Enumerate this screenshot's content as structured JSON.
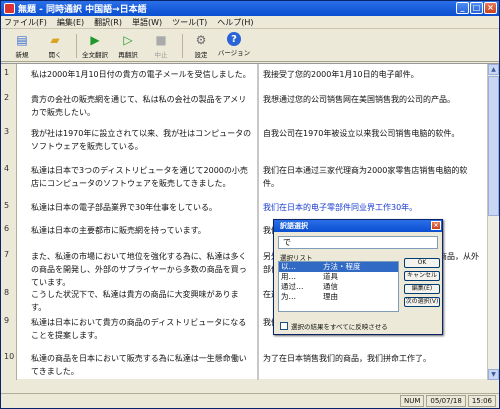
{
  "window": {
    "title": "無題 - 同時通訳 中国語→日本語"
  },
  "menu": [
    "ファイル(F)",
    "編集(E)",
    "翻訳(R)",
    "単語(W)",
    "ツール(T)",
    "ヘルプ(H)"
  ],
  "toolbar": [
    {
      "label": "新規",
      "icon": "new-doc-icon",
      "glyph": "▤"
    },
    {
      "label": "開く",
      "icon": "open-folder-icon",
      "glyph": "📂"
    },
    {
      "label": "全文翻訳",
      "icon": "translate-all-icon",
      "glyph": "▶"
    },
    {
      "label": "再翻訳",
      "icon": "retranslate-icon",
      "glyph": "▶"
    },
    {
      "label": "中止",
      "icon": "stop-icon",
      "glyph": "■",
      "disabled": true
    },
    {
      "label": "設定",
      "icon": "settings-icon",
      "glyph": "⚙"
    },
    {
      "label": "バージョン",
      "icon": "help-version-icon",
      "glyph": "?"
    }
  ],
  "rows": [
    {
      "n": "1",
      "src": "私は2000年1月10日付の貴方の電子メールを受信しました。",
      "dst": "我接受了您的2000年1月10日的电子邮件。"
    },
    {
      "n": "2",
      "src": "貴方の会社の販売網を通じて、私は私の会社の製品をアメリカで販売したい。",
      "dst": "我想通过您的公司销售网在美国销售我的公司的产品。"
    },
    {
      "n": "3",
      "src": "我が社は1970年に設立されて以来、我が社はコンピュータのソフトウェアを販売している。",
      "dst": "自我公司在1970年被设立以来我公司销售电脑的软件。"
    },
    {
      "n": "4",
      "src": "私達は日本で3つのディストリビュータを通じて2000の小売店にコンピュータのソフトウェアを販売してきました。",
      "dst": "我们在日本通过三家代理商为2000家零售店销售电脑的软件。"
    },
    {
      "n": "5",
      "src": "私達は日本の電子部品業界で30年仕事をしている。",
      "dst": "我们在日本的电子零部件同业界工作30年。"
    },
    {
      "n": "6",
      "src": "私達は日本の主要都市に販売網を持っています。",
      "dst": "我们在日本的主要城市有销售网络。"
    },
    {
      "n": "7",
      "src": "また、私達の市場において地位を強化する為に、私達は多くの商品を開発し、外部のサプライヤーから多数の商品を買っています。",
      "dst": "另外，为了在我们的市场强化地位，我们开发很多商品，从外部供应商购买多数商品。"
    },
    {
      "n": "8",
      "src": "こうした状況下で、私達は貴方の商品に大変興味があります。",
      "dst": "在这样的状况下，我们对您的商品非常感兴趣。"
    },
    {
      "n": "9",
      "src": "私達は日本において貴方の商品のディストリビュータになることを提案します。",
      "dst": "我们提议在日本成为您的商品的代理商。"
    },
    {
      "n": "10",
      "src": "私達の商品を日本において販売する為に私達は一生懸命働いてきました。",
      "dst": "为了在日本销售我们的商品，我们拼命工作了。"
    }
  ],
  "dialog": {
    "title": "訳語選択",
    "input": "で",
    "list_label": "選択リスト",
    "items": [
      {
        "a": "以…",
        "b": "方法・程度"
      },
      {
        "a": "用…",
        "b": "道具"
      },
      {
        "a": "通过…",
        "b": "通信"
      },
      {
        "a": "为…",
        "b": "理由"
      }
    ],
    "buttons": [
      "OK",
      "キャンセル",
      "編集(E)",
      "次の選択(V)"
    ],
    "checkbox": "選択の結果をすべてに反映させる"
  },
  "status": {
    "mode": "NUM",
    "date": "05/07/18",
    "time": "15:06"
  }
}
